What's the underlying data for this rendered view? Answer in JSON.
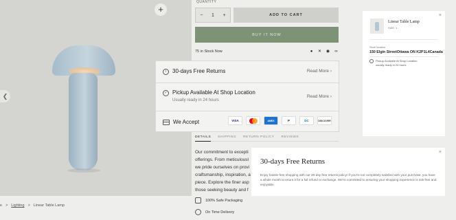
{
  "gallery": {
    "zoom_icon": "plus-icon",
    "prev_icon": "chevron-left-icon"
  },
  "breadcrumb": {
    "home_label": "e",
    "sep1": ">",
    "category": "Lighting",
    "sep2": ">",
    "current": "Linear Table Lamp"
  },
  "purchase": {
    "quantity_label": "QUANTITY",
    "quantity_value": "1",
    "minus": "−",
    "plus": "+",
    "add_to_cart": "ADD TO CART",
    "buy_now": "BUY IT NOW",
    "stock": "75 in Stock Now",
    "share_icons": [
      "facebook-icon",
      "x-icon",
      "pinterest-icon",
      "link-icon"
    ]
  },
  "info_card": {
    "returns_icon": "info-icon",
    "returns_title": "30-days Free Returns",
    "returns_link": "Read More",
    "pickup_icon": "check-circle-icon",
    "pickup_title": "Pickup Available At Shop Location",
    "pickup_sub": "Usually ready in 24 hours",
    "pickup_link": "Read More",
    "accept_icon": "credit-card-icon",
    "accept_label": "We Accept",
    "payments": [
      "VISA",
      "AMEX",
      "P",
      "DC",
      "DISCOVER"
    ]
  },
  "tabs": [
    "DETAILS",
    "SHIPPING",
    "RETURN POLICY",
    "REVIEWS"
  ],
  "description_lines": [
    "Our commitment to excepti",
    "offerings. From meticulousl",
    "we pride ourselves on provi",
    "craftsmanship, inspiration, a",
    "piece. Explore the finer asp",
    "those seeking beauty and f"
  ],
  "features": {
    "packaging": "100% Safe Packaging",
    "delivery": "On Time Delivery"
  },
  "cart_panel": {
    "close": "×",
    "product_name": "Linear Table Lamp",
    "size": "SIZE: 1",
    "pickup_label": "Store location",
    "pickup_address": "150 Elgin StreetOttawa ON K2P1L4Canada",
    "pickup_line1": "Pickup Available At Shop Location",
    "pickup_line2": "usually ready in 24 hours"
  },
  "returns_modal": {
    "close": "×",
    "title": "30-days Free Returns",
    "body": "Enjoy hassle-free shopping with our 30-day free returns policy! If you're not completely satisfied with your purchase, you have a whole month to return it for a full refund or exchange. We're committed to ensuring your shopping experience is risk-free and enjoyable."
  },
  "colors": {
    "buy_now": "#7e9276",
    "lamp": "#b7c7d1",
    "background": "#eeeeec"
  }
}
